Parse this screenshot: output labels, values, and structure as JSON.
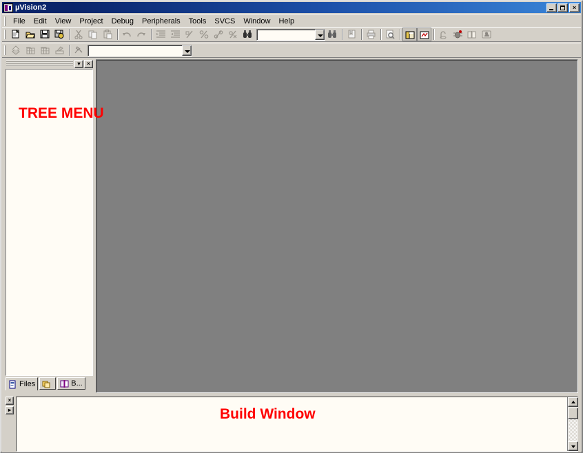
{
  "window": {
    "title": "µVision2",
    "app_icon": "uvision-icon",
    "controls": {
      "minimize": "–",
      "maximize": "□",
      "close": "×"
    }
  },
  "menubar": {
    "items": [
      {
        "label": "File",
        "accel": "F"
      },
      {
        "label": "Edit",
        "accel": "E"
      },
      {
        "label": "View",
        "accel": "V"
      },
      {
        "label": "Project",
        "accel": "P"
      },
      {
        "label": "Debug",
        "accel": "D"
      },
      {
        "label": "Peripherals",
        "accel": "P"
      },
      {
        "label": "Tools",
        "accel": "T"
      },
      {
        "label": "SVCS",
        "accel": "S"
      },
      {
        "label": "Window",
        "accel": "W"
      },
      {
        "label": "Help",
        "accel": "H"
      }
    ]
  },
  "toolbar_main": {
    "buttons": [
      {
        "name": "new-file-button",
        "icon": "new-file-icon",
        "enabled": true
      },
      {
        "name": "open-file-button",
        "icon": "open-folder-icon",
        "enabled": true
      },
      {
        "name": "save-button",
        "icon": "floppy-disk-icon",
        "enabled": true
      },
      {
        "name": "save-all-button",
        "icon": "save-all-icon",
        "enabled": true
      },
      {
        "name": "cut-button",
        "icon": "scissors-icon",
        "enabled": false
      },
      {
        "name": "copy-button",
        "icon": "copy-icon",
        "enabled": false
      },
      {
        "name": "paste-button",
        "icon": "clipboard-paste-icon",
        "enabled": false
      },
      {
        "name": "undo-button",
        "icon": "undo-arrow-icon",
        "enabled": false
      },
      {
        "name": "redo-button",
        "icon": "redo-arrow-icon",
        "enabled": false
      },
      {
        "name": "indent-button",
        "icon": "indent-icon",
        "enabled": false
      },
      {
        "name": "outdent-button",
        "icon": "outdent-icon",
        "enabled": false
      },
      {
        "name": "toggle-bookmark-button",
        "icon": "bookmark-icon",
        "enabled": false
      },
      {
        "name": "next-bookmark-button",
        "icon": "next-bookmark-icon",
        "enabled": false
      },
      {
        "name": "prev-bookmark-button",
        "icon": "prev-bookmark-icon",
        "enabled": false
      },
      {
        "name": "clear-bookmarks-button",
        "icon": "clear-bookmarks-icon",
        "enabled": false
      },
      {
        "name": "find-in-files-button",
        "icon": "binoculars-icon",
        "enabled": true
      }
    ],
    "find_combo": {
      "value": "",
      "placeholder": "",
      "dropdown": "chevron-down-icon"
    },
    "buttons_right": [
      {
        "name": "find-button",
        "icon": "binoculars-icon",
        "enabled": true
      },
      {
        "name": "bookmark-list-button",
        "icon": "bookmark-list-icon",
        "enabled": false
      },
      {
        "name": "print-button",
        "icon": "printer-icon",
        "enabled": false
      },
      {
        "name": "print-preview-button",
        "icon": "print-preview-icon",
        "enabled": false
      },
      {
        "name": "project-window-button",
        "icon": "project-window-icon",
        "enabled": true,
        "pressed": true
      },
      {
        "name": "output-window-button",
        "icon": "output-window-icon",
        "enabled": true,
        "pressed": true
      },
      {
        "name": "source-browser-button",
        "icon": "source-browser-icon",
        "enabled": false
      },
      {
        "name": "debug-button",
        "icon": "debug-icon",
        "enabled": false
      },
      {
        "name": "book-button",
        "icon": "book-icon",
        "enabled": false
      },
      {
        "name": "about-button",
        "icon": "about-icon",
        "enabled": false
      }
    ]
  },
  "toolbar_build": {
    "buttons": [
      {
        "name": "translate-file-button",
        "icon": "translate-icon",
        "enabled": false
      },
      {
        "name": "build-target-button",
        "icon": "build-icon",
        "enabled": false
      },
      {
        "name": "rebuild-all-button",
        "icon": "rebuild-icon",
        "enabled": false
      },
      {
        "name": "stop-build-button",
        "icon": "stop-build-icon",
        "enabled": false
      },
      {
        "name": "target-options-button",
        "icon": "target-options-icon",
        "enabled": false
      }
    ],
    "target_combo": {
      "value": "",
      "placeholder": "",
      "dropdown": "chevron-down-icon"
    }
  },
  "project_panel": {
    "caption_buttons": [
      {
        "name": "panel-minimize-button",
        "glyph": "▾"
      },
      {
        "name": "panel-close-button",
        "glyph": "×"
      }
    ],
    "annotation": "TREE MENU",
    "annotation_color": "#ff0000",
    "tabs": [
      {
        "label": "Files",
        "icon": "file-page-icon",
        "selected": true
      },
      {
        "label": "",
        "icon": "regs-pages-icon",
        "selected": false
      },
      {
        "label": "B...",
        "icon": "open-book-icon",
        "selected": false
      }
    ]
  },
  "mdi_area": {
    "background_color": "#808080"
  },
  "build_window": {
    "annotation": "Build Window",
    "annotation_color": "#ff0000",
    "gutter_buttons": [
      {
        "name": "build-window-close-button",
        "glyph": "×"
      },
      {
        "name": "build-window-pin-button",
        "glyph": "▸"
      }
    ],
    "scrollbar": {
      "up_arrow": "scroll-up-icon",
      "down_arrow": "scroll-down-icon"
    },
    "content": ""
  }
}
